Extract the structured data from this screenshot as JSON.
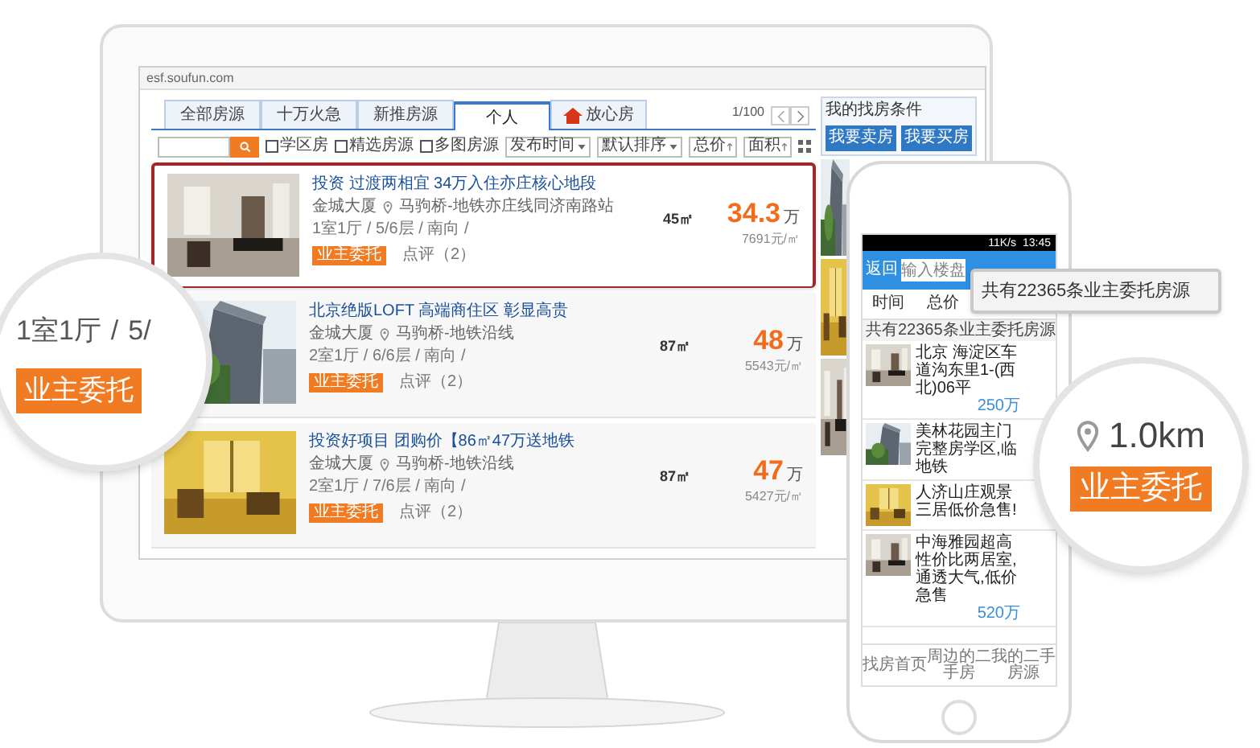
{
  "browser": {
    "address": "esf.soufun.com"
  },
  "tabs": [
    {
      "label": "全部房源",
      "selected": false,
      "kind": "plain"
    },
    {
      "label": "十万火急",
      "selected": false,
      "kind": "plain"
    },
    {
      "label": "新推房源",
      "selected": false,
      "kind": "plain"
    },
    {
      "label": "个人",
      "selected": true,
      "kind": "plain"
    },
    {
      "label": "放心房",
      "selected": false,
      "kind": "house"
    }
  ],
  "pager": "1/100",
  "filters": {
    "checkboxes": [
      {
        "label": "学区房",
        "checked": false
      },
      {
        "label": "精选房源",
        "checked": false
      },
      {
        "label": "多图房源",
        "checked": false
      }
    ],
    "selects": [
      "发布时间",
      "默认排序"
    ],
    "sort_buttons": [
      "总价",
      "面积"
    ]
  },
  "listings": [
    {
      "title": "投资 过渡两相宜 34万入住亦庄核心地段",
      "building": "金城大厦",
      "location": "马驹桥-地铁亦庄线同济南路站",
      "details": "1室1厅 / 5/6层 / 南向 /",
      "badge": "业主委托",
      "reviews": "点评（2）",
      "area": "45㎡",
      "price": "34.3",
      "price_unit": "万",
      "unit_price": "7691元/㎡",
      "selected": true
    },
    {
      "title": "北京绝版LOFT 高端商住区 彰显高贵",
      "building": "金城大厦",
      "location": "马驹桥-地铁沿线",
      "details": "2室1厅 / 6/6层 / 南向 /",
      "badge": "业主委托",
      "reviews": "点评（2）",
      "area": "87㎡",
      "price": "48",
      "price_unit": "万",
      "unit_price": "5543元/㎡",
      "selected": false
    },
    {
      "title": "投资好项目 团购价【86㎡47万送地铁",
      "building": "金城大厦",
      "location": "马驹桥-地铁沿线",
      "details": "2室1厅 / 7/6层 / 南向 /",
      "badge": "业主委托",
      "reviews": "点评（2）",
      "area": "87㎡",
      "price": "47",
      "price_unit": "万",
      "unit_price": "5427元/㎡",
      "selected": false
    }
  ],
  "sidebar": {
    "link": "我的找房条件",
    "buttons": [
      "我要卖房",
      "我要买房"
    ]
  },
  "phone": {
    "speed": "11K/s",
    "time": "13:45",
    "back": "返回",
    "search_placeholder": "输入楼盘",
    "filters": [
      "时间",
      "总价"
    ],
    "summary": "共有22365条业主委托房源",
    "items": [
      {
        "title": "北京 海淀区车道沟东里1-(西北)06平",
        "price": "250万"
      },
      {
        "title": "美林花园主门完整房学区,临地铁"
      },
      {
        "title": "人济山庄观景三居低价急售!"
      },
      {
        "title": "中海雅园超高性价比两居室,通透大气,低价急售",
        "price": "520万"
      }
    ],
    "nav": [
      "找房首页",
      "周边的二手房",
      "我的二手房源"
    ]
  },
  "callout": "共有22365条业主委托房源",
  "zoom_left": {
    "layout": "1室1厅",
    "separator": "/",
    "floor": "5/",
    "badge": "业主委托"
  },
  "zoom_right": {
    "distance": "1.0km",
    "badge": "业主委托"
  }
}
